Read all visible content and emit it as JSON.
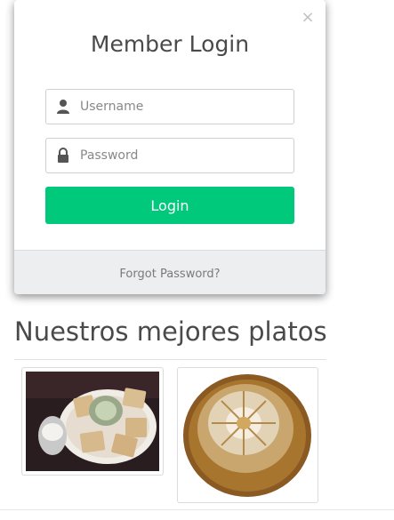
{
  "modal": {
    "title": "Member Login",
    "close_glyph": "×",
    "username": {
      "placeholder": "Username",
      "icon": "user-icon"
    },
    "password": {
      "placeholder": "Password",
      "icon": "lock-icon"
    },
    "login_label": "Login",
    "forgot_label": "Forgot Password?"
  },
  "section": {
    "title": "Nuestros mejores platos"
  },
  "colors": {
    "accent": "#00c97b",
    "footer_bg": "#eceeef",
    "text": "#4a4a4a"
  }
}
